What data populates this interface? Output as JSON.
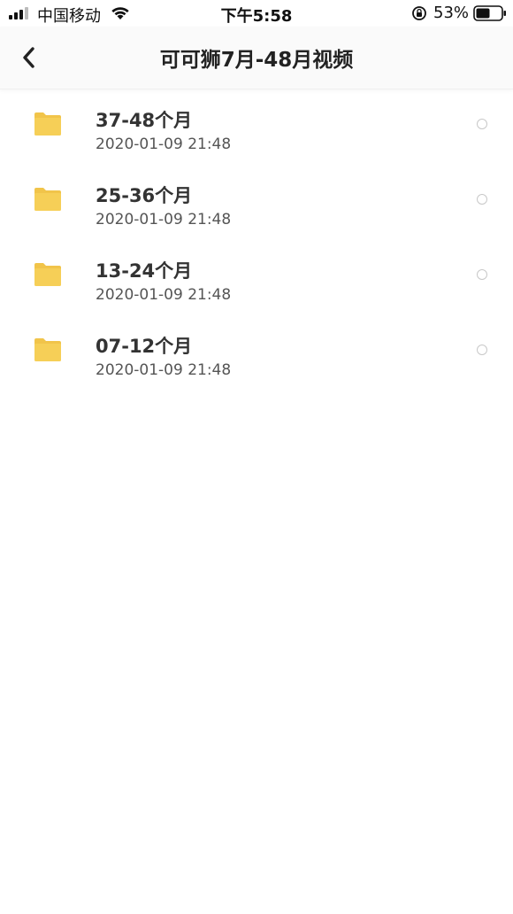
{
  "status_bar": {
    "carrier": "中国移动",
    "time": "下午5:58",
    "battery_percent": "53%",
    "icons": [
      "signal-icon",
      "wifi-icon",
      "rotation-lock-icon",
      "battery-icon"
    ]
  },
  "nav": {
    "back_icon": "chevron-left-icon",
    "title": "可可狮7月-48月视频"
  },
  "colors": {
    "folder": "#F6CF57",
    "folder_tab": "#F1C44A",
    "radio_border": "#c8c8c8"
  },
  "folders": [
    {
      "name": "37-48个月",
      "date": "2020-01-09 21:48"
    },
    {
      "name": "25-36个月",
      "date": "2020-01-09 21:48"
    },
    {
      "name": "13-24个月",
      "date": "2020-01-09 21:48"
    },
    {
      "name": "07-12个月",
      "date": "2020-01-09 21:48"
    }
  ]
}
